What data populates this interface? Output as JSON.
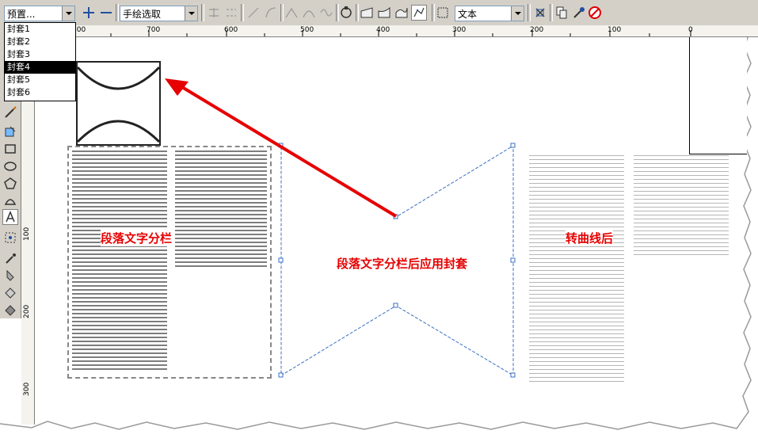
{
  "toolbar": {
    "preset_combo": "预置...",
    "mode_combo": "手绘选取",
    "text_combo": "文本"
  },
  "preset_list": {
    "items": [
      "封套1",
      "封套2",
      "封套3",
      "封套4",
      "封套5",
      "封套6"
    ],
    "selected_index": 3
  },
  "ruler": {
    "labels": [
      "800",
      "700",
      "600",
      "500",
      "400",
      "300",
      "200",
      "100",
      "0"
    ]
  },
  "vruler": {
    "labels": [
      "100",
      "200",
      "300"
    ]
  },
  "annotations": {
    "left_label": "段落文字分栏",
    "middle_label": "段落文字分栏后应用封套",
    "right_label": "转曲线后"
  },
  "colors": {
    "annotation_red": "#e60000",
    "envelope_blue": "#3a6fc4",
    "toolbar_gray": "#d4d0c8"
  }
}
